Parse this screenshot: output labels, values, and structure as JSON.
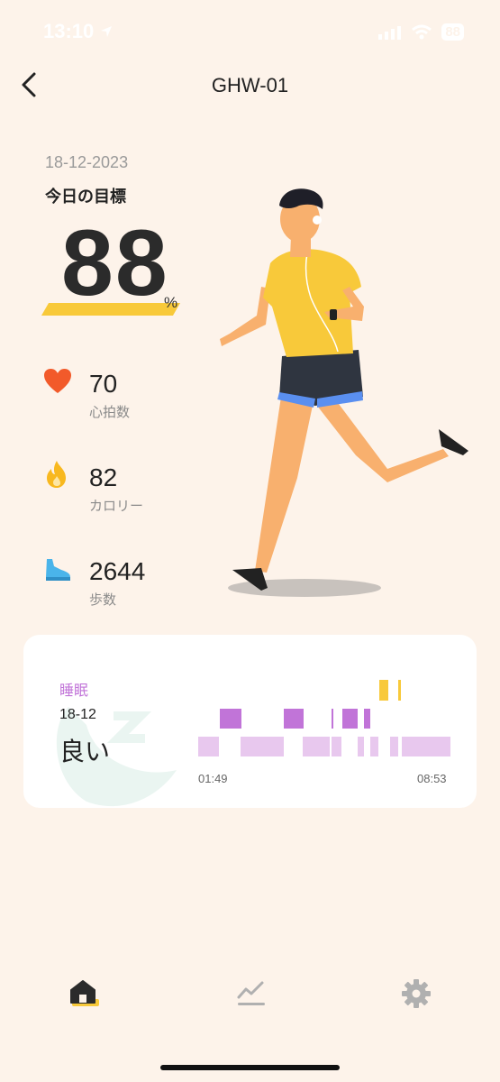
{
  "status_bar": {
    "time": "13:10",
    "battery": "88"
  },
  "header": {
    "title": "GHW-01"
  },
  "goal": {
    "date": "18-12-2023",
    "label": "今日の目標",
    "value": "88",
    "unit": "%"
  },
  "metrics": [
    {
      "icon": "heart-icon",
      "value": "70",
      "label": "心拍数",
      "color": "#f25a2a"
    },
    {
      "icon": "flame-icon",
      "value": "82",
      "label": "カロリー",
      "color": "#f8b81f"
    },
    {
      "icon": "shoe-icon",
      "value": "2644",
      "label": "歩数",
      "color": "#4ab4ea"
    }
  ],
  "sleep": {
    "title": "睡眠",
    "date": "18-12",
    "quality": "良い",
    "start_time": "01:49",
    "end_time": "08:53",
    "colors": {
      "deep": "#c174d8",
      "light": "#e8c8ee",
      "awake": "#f8c93a"
    }
  },
  "nav": {
    "items": [
      "home-icon",
      "chart-icon",
      "gear-icon"
    ],
    "active": "home-icon"
  }
}
